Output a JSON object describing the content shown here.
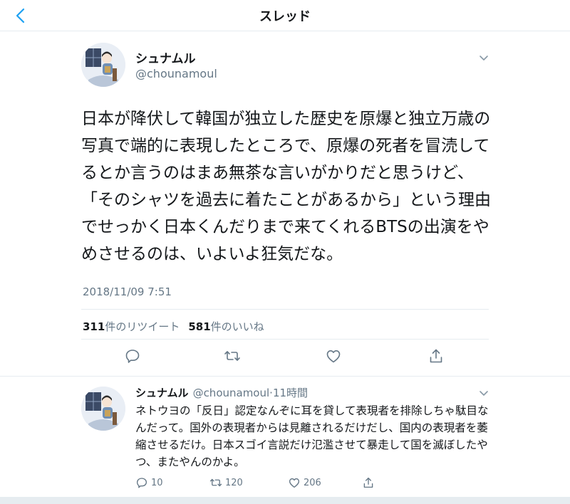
{
  "header": {
    "title": "スレッド",
    "back_icon": "chevron-left-icon",
    "accent_color": "#1da1f2"
  },
  "main_tweet": {
    "name": "シュナムル",
    "handle": "@chounamoul",
    "text": "日本が降伏して韓国が独立した歴史を原爆と独立万歳の写真で端的に表現したところで、原爆の死者を冒涜してるとか言うのはまあ無茶な言いがかりだと思うけど、「そのシャツを過去に着たことがあるから」という理由でせっかく日本くんだりまで来てくれるBTSの出演をやめさせるのは、いよいよ狂気だな。",
    "timestamp": "2018/11/09 7:51",
    "retweet_count": "311",
    "retweet_label": "件のリツイート",
    "like_count": "581",
    "like_label": "件のいいね",
    "actions": [
      "reply-icon",
      "retweet-icon",
      "like-icon",
      "share-icon"
    ]
  },
  "reply_tweet": {
    "name": "シュナムル",
    "handle": "@chounamoul",
    "separator": "·",
    "time": "11時間",
    "text": "ネトウヨの「反日」認定なんぞに耳を貸して表現者を排除しちゃ駄目なんだって。国外の表現者からは見離されるだけだし、国内の表現者を萎縮させるだけ。日本スゴイ言説だけ氾濫させて暴走して国を滅ぼしたやつ、またやんのかよ。",
    "reply_count": "10",
    "retweet_count": "120",
    "like_count": "206"
  }
}
